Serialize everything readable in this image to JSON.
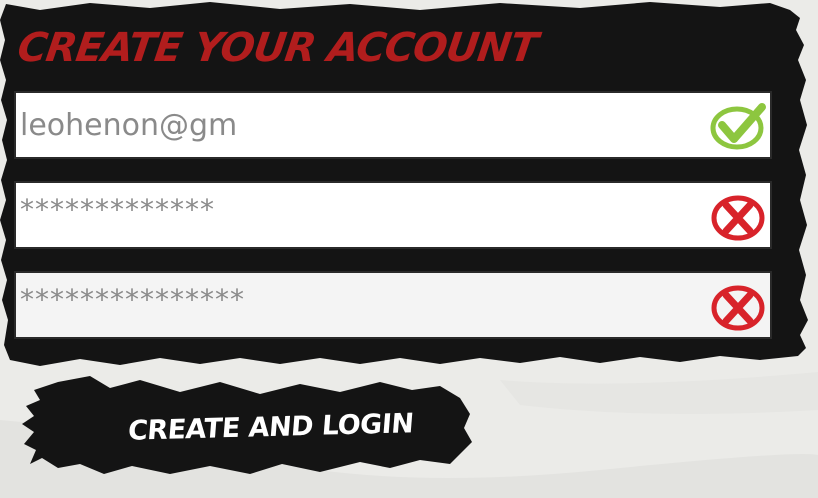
{
  "form": {
    "title": "CREATE YOUR ACCOUNT",
    "fields": [
      {
        "value": "leohenon@gm",
        "status": "valid",
        "status_icon": "checkmark-icon"
      },
      {
        "value": "*************",
        "status": "invalid",
        "status_icon": "error-x-icon"
      },
      {
        "value": "***************",
        "status": "invalid",
        "status_icon": "error-x-icon"
      }
    ],
    "submit_label": "CREATE AND LOGIN"
  },
  "colors": {
    "panel": "#141414",
    "title": "#b11d1d",
    "valid": "#8dc63f",
    "invalid": "#d8232a",
    "input_text": "#8a8a8a",
    "button_text": "#ffffff"
  }
}
